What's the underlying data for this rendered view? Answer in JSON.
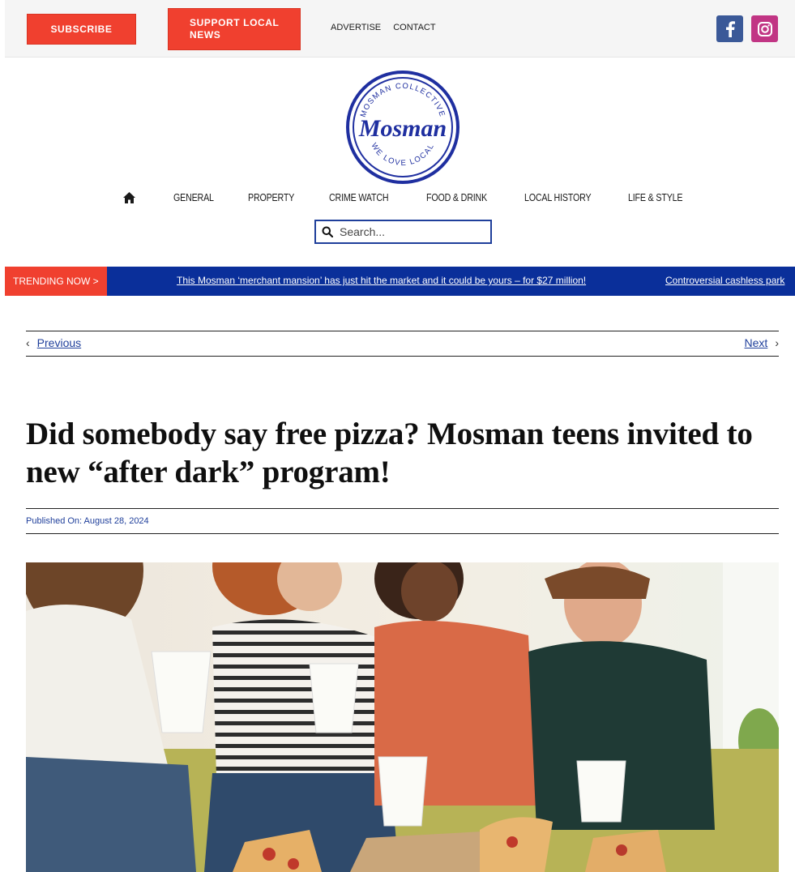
{
  "topbar": {
    "subscribe_label": "SUBSCRIBE",
    "support_label": "SUPPORT LOCAL NEWS",
    "links": [
      "ADVERTISE",
      "CONTACT"
    ],
    "social": [
      "facebook-icon",
      "instagram-icon"
    ]
  },
  "logo": {
    "name": "Mosman",
    "top_text": "MOSMAN COLLECTIVE",
    "bottom_text": "WE LOVE LOCAL"
  },
  "nav": {
    "items": [
      "GENERAL",
      "PROPERTY",
      "CRIME WATCH",
      "FOOD & DRINK",
      "LOCAL HISTORY",
      "LIFE & STYLE"
    ]
  },
  "search": {
    "placeholder": "Search..."
  },
  "trending": {
    "label": "TRENDING NOW >",
    "items": [
      "This Mosman ‘merchant mansion’ has just hit the market and it could be yours – for $27 million!",
      "Controversial cashless park"
    ]
  },
  "pager": {
    "previous": "Previous",
    "next": "Next"
  },
  "article": {
    "title": "Did somebody say free pizza? Mosman teens invited to new “after dark” program!",
    "published": "Published On: August 28, 2024"
  },
  "colors": {
    "accent_red": "#f0402f",
    "brand_blue": "#1f3f9b",
    "trending_bg": "#0a2f9a"
  }
}
